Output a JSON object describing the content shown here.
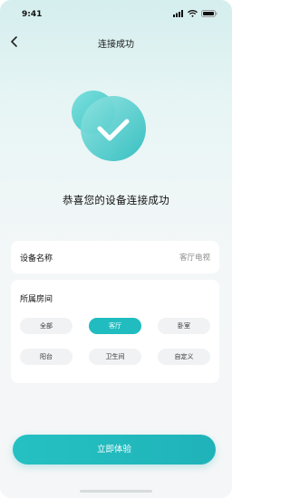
{
  "status_bar": {
    "time": "9:41"
  },
  "nav": {
    "title": "连接成功"
  },
  "success": {
    "message": "恭喜您的设备连接成功"
  },
  "device": {
    "name_label": "设备名称",
    "name_value": "客厅电视"
  },
  "room": {
    "title": "所属房间",
    "options": [
      {
        "label": "全部",
        "selected": false
      },
      {
        "label": "客厅",
        "selected": true
      },
      {
        "label": "卧室",
        "selected": false
      },
      {
        "label": "阳台",
        "selected": false
      },
      {
        "label": "卫生间",
        "selected": false
      },
      {
        "label": "自定义",
        "selected": false
      }
    ]
  },
  "cta": {
    "label": "立即体验"
  },
  "colors": {
    "accent": "#21bcbf",
    "chip_bg": "#f1f2f3"
  },
  "icons": {
    "back": "chevron-left-icon",
    "success": "checkmark-icon"
  }
}
